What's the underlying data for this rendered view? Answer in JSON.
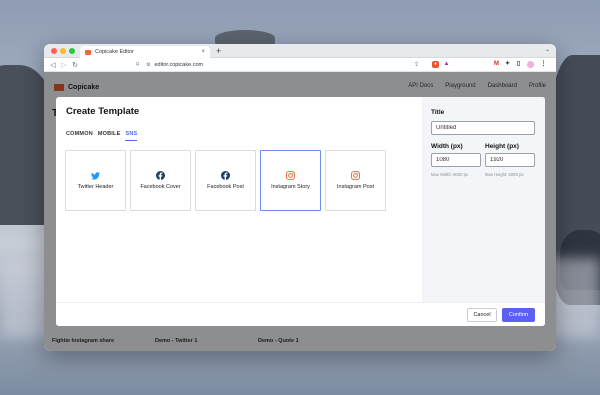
{
  "browser": {
    "tab_title": "Copicake Editor",
    "tab_close": "×",
    "new_tab": "+",
    "tab_menu": "⌄",
    "url": "editor.copicake.com"
  },
  "app": {
    "name": "Copicake",
    "nav": [
      "API Docs",
      "Playground",
      "Dashboard",
      "Profile"
    ],
    "background_title": "T",
    "card_captions": [
      "Fightie Instagram share",
      "Demo - Twitter 1",
      "Demo - Quote 1"
    ]
  },
  "modal": {
    "title": "Create Template",
    "tabs": [
      {
        "label": "COMMON",
        "active": false
      },
      {
        "label": "MOBILE",
        "active": false
      },
      {
        "label": "SNS",
        "active": true
      }
    ],
    "templates": [
      {
        "label": "Twitter Header",
        "icon": "twitter-icon",
        "color": "#1d9bf0",
        "selected": false
      },
      {
        "label": "Facebook Cover",
        "icon": "facebook-icon",
        "color": "#1f3b63",
        "selected": false
      },
      {
        "label": "Facebook Post",
        "icon": "facebook-icon",
        "color": "#1f3b63",
        "selected": false
      },
      {
        "label": "Instagram Story",
        "icon": "instagram-icon",
        "color": "#e8633a",
        "selected": true
      },
      {
        "label": "Instagram Post",
        "icon": "instagram-icon",
        "color": "#e8633a",
        "selected": false
      }
    ],
    "settings": {
      "title_label": "Title",
      "title_value": "Untitled",
      "width_label": "Width (px)",
      "width_value": "1080",
      "width_hint": "Max Width: 6000 px",
      "height_label": "Height (px)",
      "height_value": "1920",
      "height_hint": "Max Height: 6000 px"
    },
    "buttons": {
      "cancel": "Cancel",
      "confirm": "Confirm"
    }
  },
  "colors": {
    "accent": "#5b60f0",
    "active_tab": "#4a6cf7",
    "selected_border": "#6d8ef0"
  }
}
